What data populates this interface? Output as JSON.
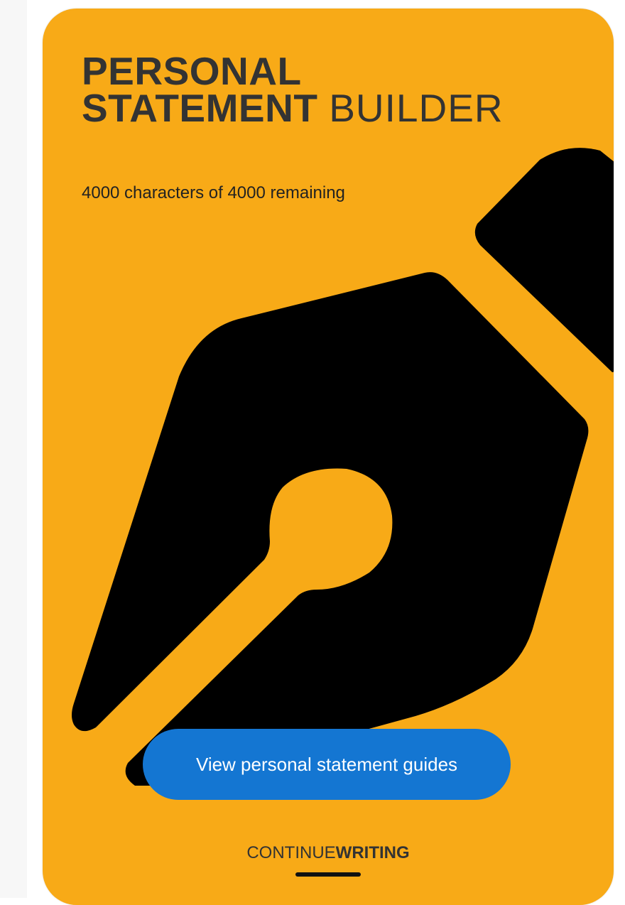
{
  "card": {
    "title_line1": "PERSONAL",
    "title_line2_bold": "STATEMENT",
    "title_line2_light": "BUILDER",
    "character_counter": "4000 characters of 4000 remaining",
    "guides_button_label": "View personal statement guides",
    "continue_label_regular": "CONTINUE",
    "continue_label_bold": "WRITING"
  },
  "colors": {
    "card_background": "#f8aa17",
    "title_text": "#333333",
    "primary_button": "#1476d2",
    "pen_icon": "#000000"
  },
  "icons": {
    "background_illustration": "fountain-pen-nib-icon"
  }
}
